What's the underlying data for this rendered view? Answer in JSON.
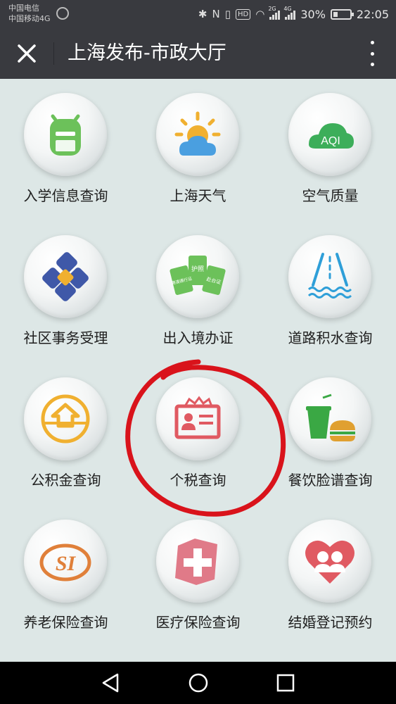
{
  "status": {
    "carrier1": "中国电信",
    "carrier2": "中国移动4G",
    "network1": "2G",
    "network2": "4G",
    "battery": "30%",
    "battery_level": 0.3,
    "hd": "HD",
    "time": "22:05"
  },
  "header": {
    "title": "上海发布-市政大厅"
  },
  "tiles": [
    {
      "label": "入学信息查询",
      "icon": "backpack-icon"
    },
    {
      "label": "上海天气",
      "icon": "weather-icon"
    },
    {
      "label": "空气质量",
      "icon": "aqi-cloud-icon",
      "icon_text": "AQI"
    },
    {
      "label": "社区事务受理",
      "icon": "community-icon"
    },
    {
      "label": "出入境办证",
      "icon": "passport-cards-icon",
      "icon_texts": [
        "护照",
        "港澳通行证",
        "赴台证"
      ]
    },
    {
      "label": "道路积水查询",
      "icon": "road-water-icon"
    },
    {
      "label": "公积金查询",
      "icon": "housing-fund-icon"
    },
    {
      "label": "个税查询",
      "icon": "tax-id-icon"
    },
    {
      "label": "餐饮脸谱查询",
      "icon": "food-drink-icon"
    },
    {
      "label": "养老保险查询",
      "icon": "social-insurance-icon",
      "icon_text": "SI"
    },
    {
      "label": "医疗保险查询",
      "icon": "medical-cross-icon"
    },
    {
      "label": "结婚登记预约",
      "icon": "marriage-heart-icon"
    }
  ],
  "colors": {
    "bar": "#393a3f",
    "background": "#dde7e6",
    "green": "#6cc15a",
    "blue": "#4a9fe0",
    "orange": "#f0b030",
    "red": "#e05a62",
    "annotation": "#d9131b"
  }
}
